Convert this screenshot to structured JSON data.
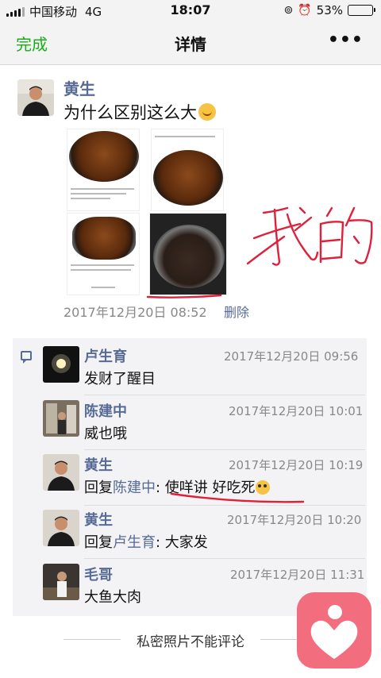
{
  "status_bar": {
    "carrier": "中国移动",
    "network": "4G",
    "time": "18:07",
    "battery_percent": "53%",
    "battery_level": 0.53
  },
  "nav": {
    "back_label": "完成",
    "title": "详情",
    "more_label": "•••"
  },
  "post": {
    "author": "黄生",
    "text": "为什么区别这么大",
    "time": "2017年12月20日 08:52",
    "delete_label": "删除",
    "photo_count": 4
  },
  "comments": [
    {
      "name": "卢生育",
      "time": "2017年12月20日 09:56",
      "text": "发财了醒目"
    },
    {
      "name": "陈建中",
      "time": "2017年12月20日 10:01",
      "text": "威也哦"
    },
    {
      "name": "黄生",
      "time": "2017年12月20日 10:19",
      "reply_prefix": "回复",
      "reply_to": "陈建中",
      "reply_sep": ": ",
      "text": "使咩讲 好吃死"
    },
    {
      "name": "黄生",
      "time": "2017年12月20日 10:20",
      "reply_prefix": "回复",
      "reply_to": "卢生育",
      "reply_sep": ": ",
      "text": "大家发"
    },
    {
      "name": "毛哥",
      "time": "2017年12月20日 11:31",
      "text": "大鱼大肉"
    }
  ],
  "footer": {
    "private_note": "私密照片不能评论"
  },
  "colors": {
    "accent_green": "#1aad19",
    "link_blue": "#576b95",
    "annotation_red": "#e0203a",
    "app_icon": "#f26d7d"
  }
}
